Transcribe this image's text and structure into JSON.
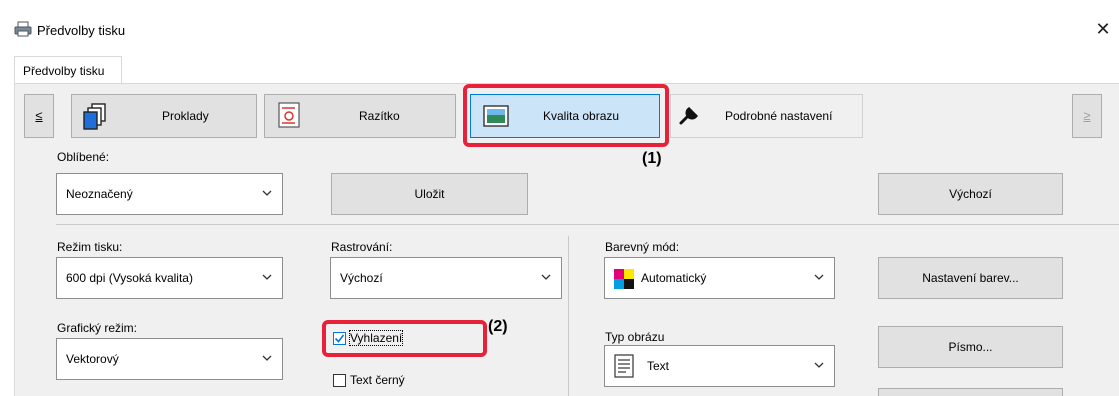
{
  "window": {
    "title": "Předvolby tisku",
    "close_label": "✕"
  },
  "tabs": [
    {
      "label": "Předvolby tisku"
    }
  ],
  "nav": {
    "prev_label": "≤",
    "next_label": "≥",
    "items": [
      {
        "label": "Proklady",
        "icon": "stacked-pages-icon"
      },
      {
        "label": "Razítko",
        "icon": "stamp-icon"
      },
      {
        "label": "Kvalita obrazu",
        "icon": "image-quality-icon",
        "selected": true
      },
      {
        "label": "Podrobné nastavení",
        "icon": "wrench-icon"
      }
    ]
  },
  "favorites": {
    "label": "Oblíbené:",
    "value": "Neoznačený",
    "save_label": "Uložit",
    "default_label": "Výchozí"
  },
  "print_mode": {
    "label": "Režim tisku:",
    "value": "600 dpi (Vysoká kvalita)"
  },
  "rasterization": {
    "label": "Rastrování:",
    "value": "Výchozí"
  },
  "color_mode": {
    "label": "Barevný mód:",
    "value": "Automatický"
  },
  "color_settings_label": "Nastavení barev...",
  "graphics_mode": {
    "label": "Grafický režim:",
    "value": "Vektorový"
  },
  "smoothing": {
    "label": "Vyhlazení",
    "checked": true
  },
  "text_black": {
    "label": "Text černý",
    "checked": false
  },
  "image_type": {
    "label": "Typ obrázu",
    "value": "Text"
  },
  "font_label": "Písmo...",
  "callouts": {
    "one": "(1)",
    "two": "(2)",
    "color": "#e8213a"
  },
  "colors": {
    "selected_fill": "#cce4f7",
    "selected_border": "#0078d7",
    "panel_bg": "#f0f0f0"
  }
}
